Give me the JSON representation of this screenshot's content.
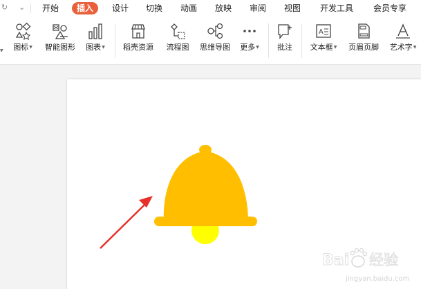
{
  "menu": {
    "quick_icons": [
      "redo-icon",
      "dropdown-icon"
    ],
    "tabs": [
      {
        "label": "开始",
        "active": false
      },
      {
        "label": "插入",
        "active": true
      },
      {
        "label": "设计",
        "active": false
      },
      {
        "label": "切换",
        "active": false
      },
      {
        "label": "动画",
        "active": false
      },
      {
        "label": "放映",
        "active": false
      },
      {
        "label": "审阅",
        "active": false
      },
      {
        "label": "视图",
        "active": false
      },
      {
        "label": "开发工具",
        "active": false
      },
      {
        "label": "会员专享",
        "active": false
      }
    ],
    "active_color": "#e9613c"
  },
  "ribbon": {
    "items": [
      {
        "label": "图标",
        "icon": "icons-icon",
        "dropdown": true
      },
      {
        "label": "智能图形",
        "icon": "smart-art-icon",
        "dropdown": false
      },
      {
        "label": "图表",
        "icon": "chart-icon",
        "dropdown": true
      },
      {
        "label": "稻壳资源",
        "icon": "docer-resources-icon",
        "dropdown": false
      },
      {
        "label": "流程图",
        "icon": "flowchart-icon",
        "dropdown": false
      },
      {
        "label": "思维导图",
        "icon": "mind-map-icon",
        "dropdown": false
      },
      {
        "label": "更多",
        "icon": "more-icon",
        "dropdown": true
      },
      {
        "label": "批注",
        "icon": "comment-icon",
        "dropdown": false
      },
      {
        "label": "文本框",
        "icon": "text-box-icon",
        "dropdown": true
      },
      {
        "label": "页眉页脚",
        "icon": "header-footer-icon",
        "dropdown": false
      },
      {
        "label": "艺术字",
        "icon": "word-art-icon",
        "dropdown": true
      }
    ]
  },
  "slide": {
    "bell_color": "#ffbf00",
    "clapper_color": "#ffff00",
    "arrow_color": "#e8302a"
  },
  "watermark": {
    "brand": "Bai",
    "brand_suffix": "经验",
    "url": "jingyan.baidu.com"
  }
}
